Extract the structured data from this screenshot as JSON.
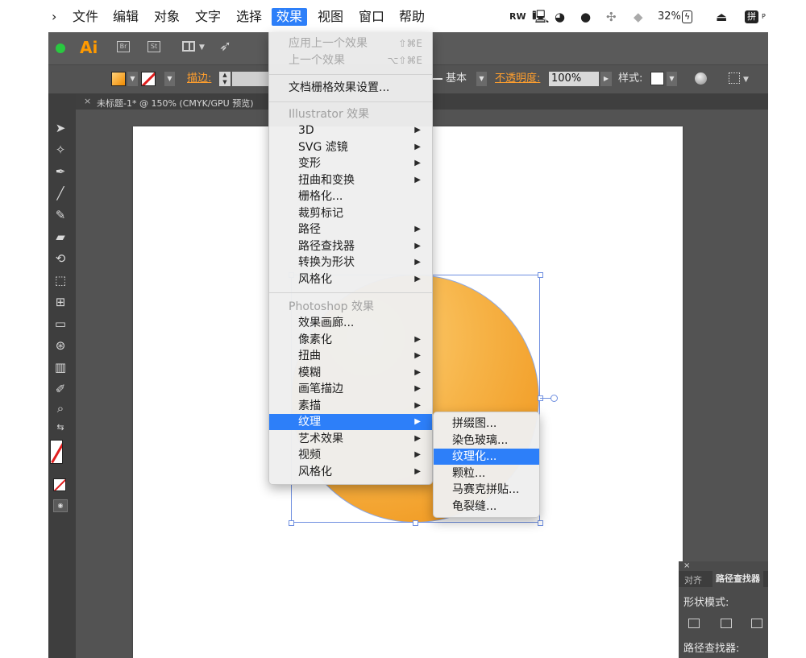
{
  "menubar": {
    "apple_partial": "›",
    "items": [
      "文件",
      "编辑",
      "对象",
      "文字",
      "选择",
      "效果",
      "视图",
      "窗口",
      "帮助"
    ],
    "active_index": 5,
    "tray": {
      "battery": "32%",
      "ime": "拼",
      "ime_suffix": "P"
    }
  },
  "app": {
    "logo": "Ai",
    "bridge": "Br",
    "stock": "St"
  },
  "control_bar": {
    "stroke_label": "描边:",
    "profile": "基本",
    "opacity_label": "不透明度:",
    "opacity_value": "100%",
    "style_label": "样式:"
  },
  "document_tab": {
    "close": "×",
    "title": "未标题-1* @ 150% (CMYK/GPU 预览)"
  },
  "effect_menu": {
    "apply_last": {
      "label": "应用上一个效果",
      "shortcut": "⇧⌘E"
    },
    "last_effect": {
      "label": "上一个效果",
      "shortcut": "⌥⇧⌘E"
    },
    "doc_raster": "文档栅格效果设置...",
    "illustrator_header": "Illustrator 效果",
    "illustrator_items": [
      {
        "label": "3D",
        "submenu": true
      },
      {
        "label": "SVG 滤镜",
        "submenu": true
      },
      {
        "label": "变形",
        "submenu": true
      },
      {
        "label": "扭曲和变换",
        "submenu": true
      },
      {
        "label": "栅格化...",
        "submenu": false
      },
      {
        "label": "裁剪标记",
        "submenu": false
      },
      {
        "label": "路径",
        "submenu": true
      },
      {
        "label": "路径查找器",
        "submenu": true
      },
      {
        "label": "转换为形状",
        "submenu": true
      },
      {
        "label": "风格化",
        "submenu": true
      }
    ],
    "photoshop_header": "Photoshop 效果",
    "photoshop_items": [
      {
        "label": "效果画廊...",
        "submenu": false
      },
      {
        "label": "像素化",
        "submenu": true
      },
      {
        "label": "扭曲",
        "submenu": true
      },
      {
        "label": "模糊",
        "submenu": true
      },
      {
        "label": "画笔描边",
        "submenu": true
      },
      {
        "label": "素描",
        "submenu": true
      },
      {
        "label": "纹理",
        "submenu": true,
        "highlighted": true
      },
      {
        "label": "艺术效果",
        "submenu": true
      },
      {
        "label": "视频",
        "submenu": true
      },
      {
        "label": "风格化",
        "submenu": true
      }
    ]
  },
  "texture_submenu": {
    "items": [
      "拼缀图...",
      "染色玻璃...",
      "纹理化...",
      "颗粒...",
      "马赛克拼贴...",
      "龟裂缝..."
    ],
    "highlighted_index": 2
  },
  "pathfinder_panel": {
    "close": "×",
    "tab_align": "对齐",
    "tab_pathfinder": "路径查找器",
    "shape_modes_label": "形状模式:",
    "pathfinders_label": "路径查找器:"
  },
  "colors": {
    "menu_highlight": "#2d7ff9",
    "accent_orange": "#ff9a00",
    "fill_gradient_light": "#ffd27a",
    "fill_gradient_dark": "#ef8f12",
    "selection_blue": "#6f8fe0"
  }
}
